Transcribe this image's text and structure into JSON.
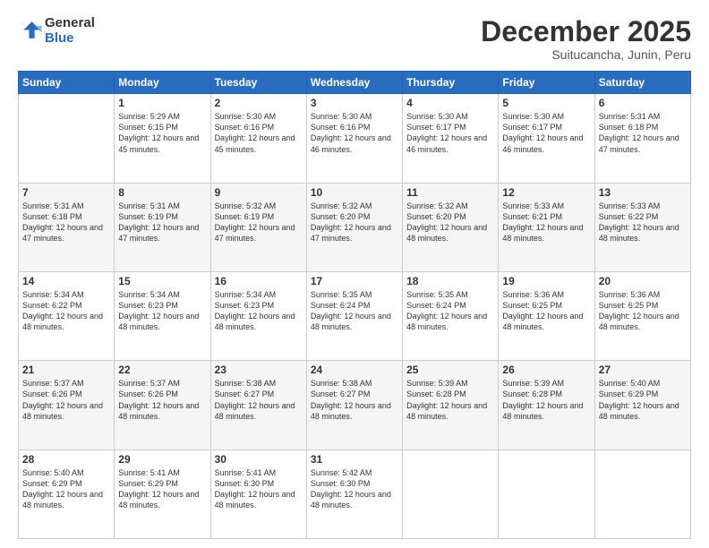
{
  "logo": {
    "line1": "General",
    "line2": "Blue"
  },
  "header": {
    "month": "December 2025",
    "location": "Suitucancha, Junin, Peru"
  },
  "days_of_week": [
    "Sunday",
    "Monday",
    "Tuesday",
    "Wednesday",
    "Thursday",
    "Friday",
    "Saturday"
  ],
  "weeks": [
    [
      {
        "day": "",
        "sunrise": "",
        "sunset": "",
        "daylight": ""
      },
      {
        "day": "1",
        "sunrise": "Sunrise: 5:29 AM",
        "sunset": "Sunset: 6:15 PM",
        "daylight": "Daylight: 12 hours and 45 minutes."
      },
      {
        "day": "2",
        "sunrise": "Sunrise: 5:30 AM",
        "sunset": "Sunset: 6:16 PM",
        "daylight": "Daylight: 12 hours and 45 minutes."
      },
      {
        "day": "3",
        "sunrise": "Sunrise: 5:30 AM",
        "sunset": "Sunset: 6:16 PM",
        "daylight": "Daylight: 12 hours and 46 minutes."
      },
      {
        "day": "4",
        "sunrise": "Sunrise: 5:30 AM",
        "sunset": "Sunset: 6:17 PM",
        "daylight": "Daylight: 12 hours and 46 minutes."
      },
      {
        "day": "5",
        "sunrise": "Sunrise: 5:30 AM",
        "sunset": "Sunset: 6:17 PM",
        "daylight": "Daylight: 12 hours and 46 minutes."
      },
      {
        "day": "6",
        "sunrise": "Sunrise: 5:31 AM",
        "sunset": "Sunset: 6:18 PM",
        "daylight": "Daylight: 12 hours and 47 minutes."
      }
    ],
    [
      {
        "day": "7",
        "sunrise": "Sunrise: 5:31 AM",
        "sunset": "Sunset: 6:18 PM",
        "daylight": "Daylight: 12 hours and 47 minutes."
      },
      {
        "day": "8",
        "sunrise": "Sunrise: 5:31 AM",
        "sunset": "Sunset: 6:19 PM",
        "daylight": "Daylight: 12 hours and 47 minutes."
      },
      {
        "day": "9",
        "sunrise": "Sunrise: 5:32 AM",
        "sunset": "Sunset: 6:19 PM",
        "daylight": "Daylight: 12 hours and 47 minutes."
      },
      {
        "day": "10",
        "sunrise": "Sunrise: 5:32 AM",
        "sunset": "Sunset: 6:20 PM",
        "daylight": "Daylight: 12 hours and 47 minutes."
      },
      {
        "day": "11",
        "sunrise": "Sunrise: 5:32 AM",
        "sunset": "Sunset: 6:20 PM",
        "daylight": "Daylight: 12 hours and 48 minutes."
      },
      {
        "day": "12",
        "sunrise": "Sunrise: 5:33 AM",
        "sunset": "Sunset: 6:21 PM",
        "daylight": "Daylight: 12 hours and 48 minutes."
      },
      {
        "day": "13",
        "sunrise": "Sunrise: 5:33 AM",
        "sunset": "Sunset: 6:22 PM",
        "daylight": "Daylight: 12 hours and 48 minutes."
      }
    ],
    [
      {
        "day": "14",
        "sunrise": "Sunrise: 5:34 AM",
        "sunset": "Sunset: 6:22 PM",
        "daylight": "Daylight: 12 hours and 48 minutes."
      },
      {
        "day": "15",
        "sunrise": "Sunrise: 5:34 AM",
        "sunset": "Sunset: 6:23 PM",
        "daylight": "Daylight: 12 hours and 48 minutes."
      },
      {
        "day": "16",
        "sunrise": "Sunrise: 5:34 AM",
        "sunset": "Sunset: 6:23 PM",
        "daylight": "Daylight: 12 hours and 48 minutes."
      },
      {
        "day": "17",
        "sunrise": "Sunrise: 5:35 AM",
        "sunset": "Sunset: 6:24 PM",
        "daylight": "Daylight: 12 hours and 48 minutes."
      },
      {
        "day": "18",
        "sunrise": "Sunrise: 5:35 AM",
        "sunset": "Sunset: 6:24 PM",
        "daylight": "Daylight: 12 hours and 48 minutes."
      },
      {
        "day": "19",
        "sunrise": "Sunrise: 5:36 AM",
        "sunset": "Sunset: 6:25 PM",
        "daylight": "Daylight: 12 hours and 48 minutes."
      },
      {
        "day": "20",
        "sunrise": "Sunrise: 5:36 AM",
        "sunset": "Sunset: 6:25 PM",
        "daylight": "Daylight: 12 hours and 48 minutes."
      }
    ],
    [
      {
        "day": "21",
        "sunrise": "Sunrise: 5:37 AM",
        "sunset": "Sunset: 6:26 PM",
        "daylight": "Daylight: 12 hours and 48 minutes."
      },
      {
        "day": "22",
        "sunrise": "Sunrise: 5:37 AM",
        "sunset": "Sunset: 6:26 PM",
        "daylight": "Daylight: 12 hours and 48 minutes."
      },
      {
        "day": "23",
        "sunrise": "Sunrise: 5:38 AM",
        "sunset": "Sunset: 6:27 PM",
        "daylight": "Daylight: 12 hours and 48 minutes."
      },
      {
        "day": "24",
        "sunrise": "Sunrise: 5:38 AM",
        "sunset": "Sunset: 6:27 PM",
        "daylight": "Daylight: 12 hours and 48 minutes."
      },
      {
        "day": "25",
        "sunrise": "Sunrise: 5:39 AM",
        "sunset": "Sunset: 6:28 PM",
        "daylight": "Daylight: 12 hours and 48 minutes."
      },
      {
        "day": "26",
        "sunrise": "Sunrise: 5:39 AM",
        "sunset": "Sunset: 6:28 PM",
        "daylight": "Daylight: 12 hours and 48 minutes."
      },
      {
        "day": "27",
        "sunrise": "Sunrise: 5:40 AM",
        "sunset": "Sunset: 6:29 PM",
        "daylight": "Daylight: 12 hours and 48 minutes."
      }
    ],
    [
      {
        "day": "28",
        "sunrise": "Sunrise: 5:40 AM",
        "sunset": "Sunset: 6:29 PM",
        "daylight": "Daylight: 12 hours and 48 minutes."
      },
      {
        "day": "29",
        "sunrise": "Sunrise: 5:41 AM",
        "sunset": "Sunset: 6:29 PM",
        "daylight": "Daylight: 12 hours and 48 minutes."
      },
      {
        "day": "30",
        "sunrise": "Sunrise: 5:41 AM",
        "sunset": "Sunset: 6:30 PM",
        "daylight": "Daylight: 12 hours and 48 minutes."
      },
      {
        "day": "31",
        "sunrise": "Sunrise: 5:42 AM",
        "sunset": "Sunset: 6:30 PM",
        "daylight": "Daylight: 12 hours and 48 minutes."
      },
      {
        "day": "",
        "sunrise": "",
        "sunset": "",
        "daylight": ""
      },
      {
        "day": "",
        "sunrise": "",
        "sunset": "",
        "daylight": ""
      },
      {
        "day": "",
        "sunrise": "",
        "sunset": "",
        "daylight": ""
      }
    ]
  ]
}
